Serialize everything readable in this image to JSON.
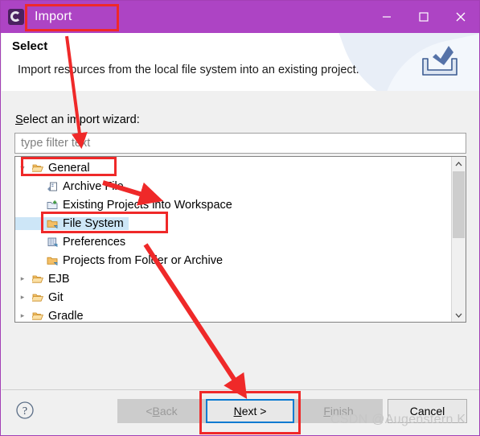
{
  "window": {
    "title": "Import",
    "app_icon": "eclipse-icon",
    "titlebar_color": "#ad44c4",
    "controls": [
      {
        "name": "minimize",
        "glyph": "minimize-icon"
      },
      {
        "name": "maximize",
        "glyph": "maximize-icon"
      },
      {
        "name": "close",
        "glyph": "close-icon"
      }
    ]
  },
  "header": {
    "title": "Select",
    "description": "Import resources from the local file system into an existing project.",
    "icon": "import-tray-icon"
  },
  "form": {
    "label": "Select an import wizard:",
    "label_mnemonic": "S",
    "filter": {
      "value": "",
      "placeholder": "type filter text"
    }
  },
  "tree": {
    "items": [
      {
        "label": "General",
        "level": 0,
        "expanded": true,
        "icon": "folder-open-icon",
        "selected": false
      },
      {
        "label": "Archive File",
        "level": 1,
        "expanded": null,
        "icon": "archive-file-icon",
        "selected": false
      },
      {
        "label": "Existing Projects into Workspace",
        "level": 1,
        "expanded": null,
        "icon": "projects-import-icon",
        "selected": false
      },
      {
        "label": "File System",
        "level": 1,
        "expanded": null,
        "icon": "folder-icon",
        "selected": true
      },
      {
        "label": "Preferences",
        "level": 1,
        "expanded": null,
        "icon": "preferences-icon",
        "selected": false
      },
      {
        "label": "Projects from Folder or Archive",
        "level": 1,
        "expanded": null,
        "icon": "folder-icon",
        "selected": false
      },
      {
        "label": "EJB",
        "level": 0,
        "expanded": false,
        "icon": "folder-open-icon",
        "selected": false
      },
      {
        "label": "Git",
        "level": 0,
        "expanded": false,
        "icon": "folder-open-icon",
        "selected": false
      },
      {
        "label": "Gradle",
        "level": 0,
        "expanded": false,
        "icon": "folder-open-icon",
        "selected": false
      }
    ],
    "scrollbar": {
      "up": "chevron-up-icon",
      "down": "chevron-down-icon"
    }
  },
  "footer": {
    "help": "help-icon",
    "buttons": [
      {
        "id": "back",
        "label": "< Back",
        "mnemonic": "B",
        "state": "disabled"
      },
      {
        "id": "next",
        "label": "Next >",
        "mnemonic": "N",
        "state": "focused"
      },
      {
        "id": "finish",
        "label": "Finish",
        "mnemonic": "F",
        "state": "disabled"
      },
      {
        "id": "cancel",
        "label": "Cancel",
        "mnemonic": "",
        "state": "enabled"
      }
    ],
    "watermark": "CSDN @Augenstern K"
  },
  "annotations": {
    "color": "#ef2929",
    "boxes": [
      "title-highlight",
      "general-highlight",
      "file-system-highlight",
      "next-highlight"
    ],
    "arrows": [
      "title-to-filter",
      "general-to-existing-projects",
      "file-system-to-next"
    ]
  }
}
